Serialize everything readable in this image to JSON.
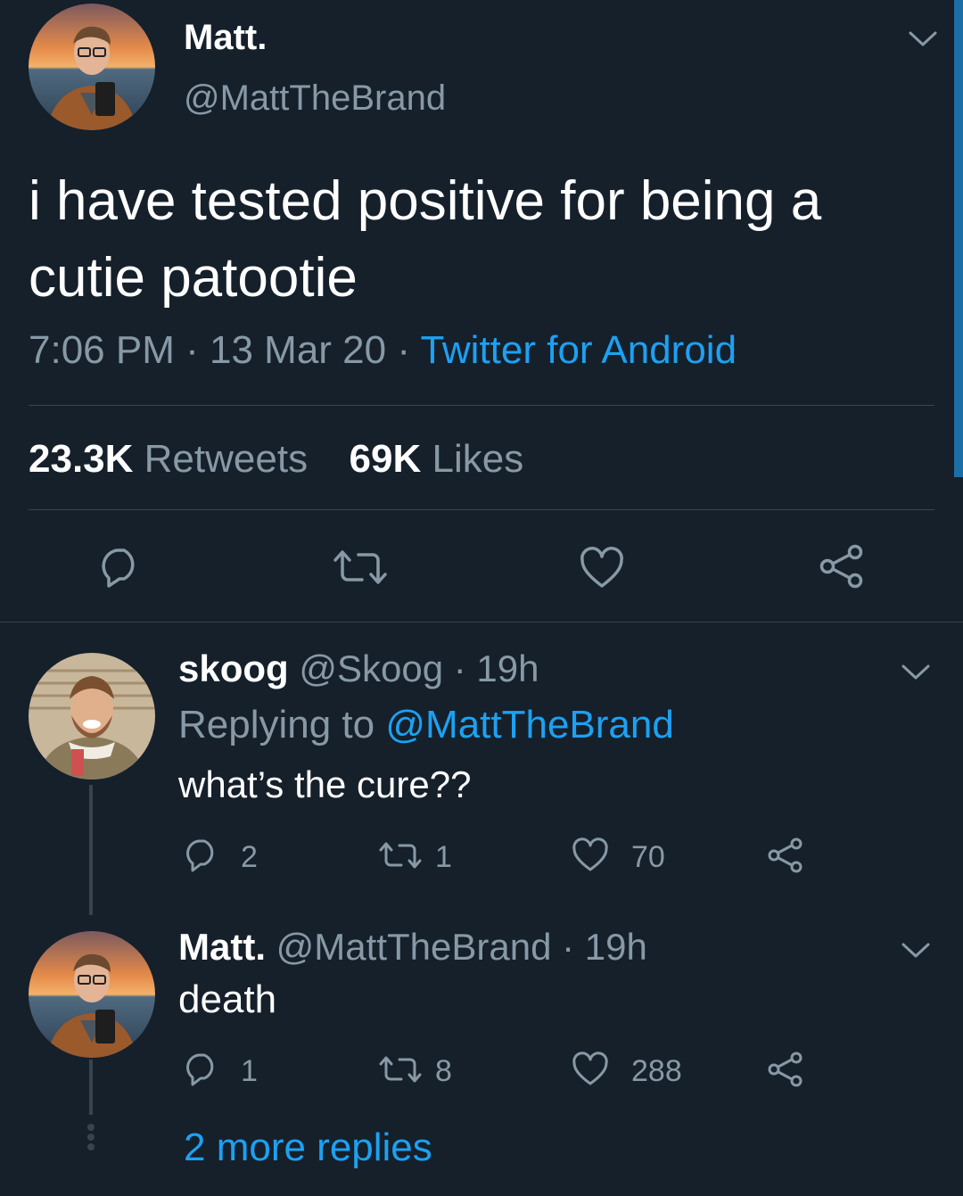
{
  "main_tweet": {
    "display_name": "Matt.",
    "handle": "@MattTheBrand",
    "text_line1": "i have tested positive for being a",
    "text_line2": "cutie patootie",
    "time": "7:06 PM",
    "date": "13 Mar 20",
    "source": "Twitter for Android",
    "separator": "·",
    "retweet_count": "23.3K",
    "retweet_label": "Retweets",
    "like_count": "69K",
    "like_label": "Likes"
  },
  "replies": [
    {
      "display_name": "skoog",
      "handle": "@Skoog",
      "age": "· 19h",
      "replying_prefix": "Replying to",
      "replying_handle": "@MattTheBrand",
      "text": "what’s the cure??",
      "reply_count": "2",
      "retweet_count": "1",
      "like_count": "70"
    },
    {
      "display_name": "Matt.",
      "handle": "@MattTheBrand",
      "age": "· 19h",
      "text": "death",
      "reply_count": "1",
      "retweet_count": "8",
      "like_count": "288"
    }
  ],
  "more_replies": "2 more replies",
  "icons": [
    "chevron-down-icon",
    "reply-icon",
    "retweet-icon",
    "heart-icon",
    "share-icon"
  ],
  "colors": {
    "background": "#15202b",
    "muted": "#8899a6",
    "link": "#1da1f2",
    "divider": "#38444d"
  }
}
